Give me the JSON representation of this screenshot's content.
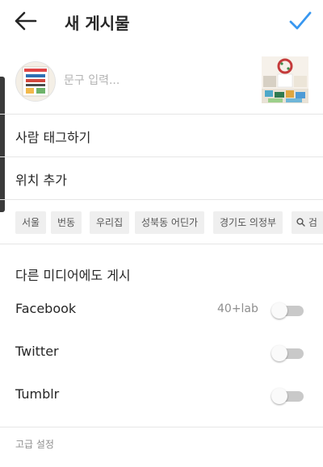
{
  "header": {
    "title": "새 게시물",
    "back_icon": "arrow-left-icon",
    "confirm_icon": "checkmark-icon",
    "accent_color": "#3897f0"
  },
  "caption": {
    "placeholder": "문구 입력...",
    "value": ""
  },
  "menu": {
    "tag_people": "사람 태그하기",
    "add_location": "위치 추가"
  },
  "location_chips": [
    "서울",
    "번동",
    "우리집",
    "성북동 어딘가",
    "경기도 의정부",
    "검"
  ],
  "share": {
    "section_title": "다른 미디어에도 게시",
    "items": [
      {
        "label": "Facebook",
        "account": "40+lab",
        "enabled": false
      },
      {
        "label": "Twitter",
        "account": "",
        "enabled": false
      },
      {
        "label": "Tumblr",
        "account": "",
        "enabled": false
      }
    ]
  },
  "advanced_settings": "고급 설정"
}
